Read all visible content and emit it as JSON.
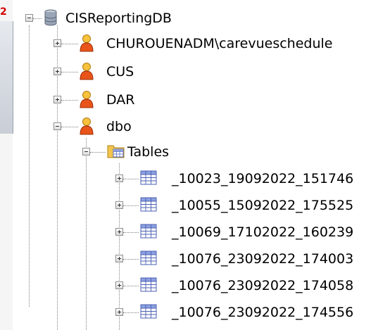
{
  "tree": {
    "root": {
      "label": "CISReportingDB",
      "icon": "database-icon",
      "expanded": true
    },
    "users": [
      {
        "label": "CHUROUENADM\\carevueschedule",
        "icon": "user-icon",
        "expanded": false
      },
      {
        "label": "CUS",
        "icon": "user-icon",
        "expanded": false
      },
      {
        "label": "DAR",
        "icon": "user-icon",
        "expanded": false
      },
      {
        "label": "dbo",
        "icon": "user-icon",
        "expanded": true
      }
    ],
    "folder": {
      "label": "Tables",
      "icon": "folder-icon",
      "expanded": true
    },
    "tables": [
      {
        "label": "_10023_19092022_151746",
        "icon": "table-icon"
      },
      {
        "label": "_10055_15092022_175525",
        "icon": "table-icon"
      },
      {
        "label": "_10069_17102022_160239",
        "icon": "table-icon"
      },
      {
        "label": "_10076_23092022_174003",
        "icon": "table-icon"
      },
      {
        "label": "_10076_23092022_174058",
        "icon": "table-icon"
      },
      {
        "label": "_10076_23092022_174556",
        "icon": "table-icon"
      }
    ]
  },
  "left_marker": "2",
  "colors": {
    "user": "#e8541a",
    "database": "#8a96a8",
    "folder": "#f2c44e",
    "table": "#5a6fc2"
  }
}
